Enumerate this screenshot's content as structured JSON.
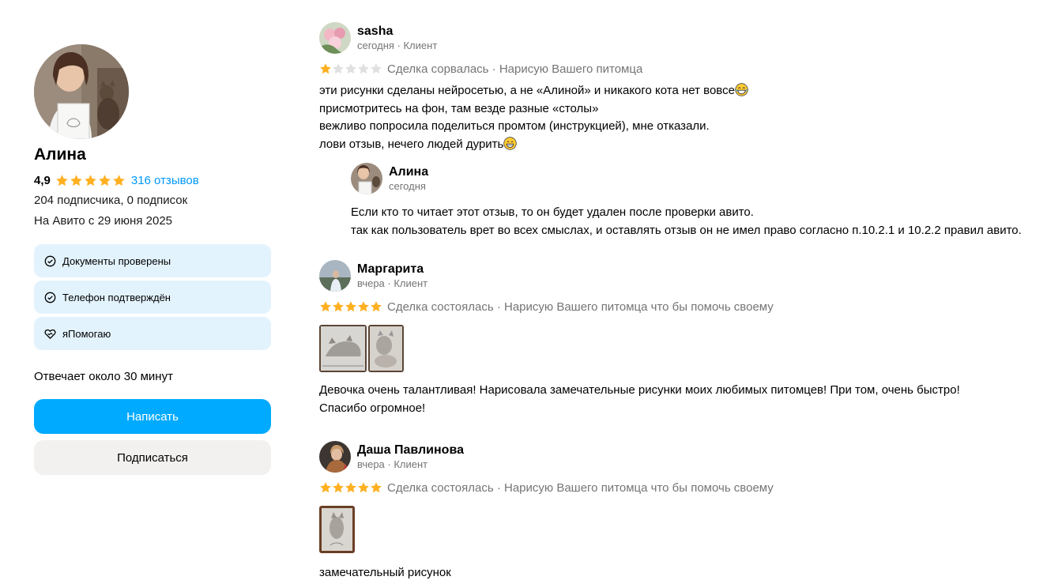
{
  "profile": {
    "name": "Алина",
    "rating": "4,9",
    "rating_stars": 5,
    "reviews_link": "316 отзывов",
    "followers": "204 подписчика, 0 подписок",
    "since": "На Авито с 29 июня 2025",
    "badges": [
      {
        "label": "Документы проверены",
        "icon": "check-circle-icon"
      },
      {
        "label": "Телефон подтверждён",
        "icon": "check-circle-icon"
      },
      {
        "label": "яПомогаю",
        "icon": "heart-hands-icon"
      }
    ],
    "responds": "Отвечает около 30 минут",
    "write_label": "Написать",
    "subscribe_label": "Подписаться"
  },
  "colors": {
    "accent": "#00aaff",
    "link": "#0099f7",
    "star": "#ffb021",
    "star_empty": "#e0e0e0",
    "badge_bg": "#e3f3fd",
    "button_secondary": "#f2f1f0"
  },
  "reviews": [
    {
      "author": "sasha",
      "meta": "сегодня · Клиент",
      "rating": 1,
      "deal": "Сделка сорвалась · Нарисую Вашего питомца",
      "lines": [
        "эти рисунки сделаны нейросетью, а не «Алиной» и никакого кота нет вовсе",
        "присмотритесь на фон, там везде разные «столы»",
        "вежливо попросила поделиться промтом (инструкцией), мне отказали.",
        "лови отзыв, нечего людей дурить"
      ],
      "reply": {
        "author": "Алина",
        "meta": "сегодня",
        "lines": [
          "Если кто то читает этот отзыв, то он будет удален после проверки авито.",
          "так как пользователь врет во всех смыслах, и оставлять отзыв он не имел право согласно п.10.2.1 и 10.2.2 правил авито."
        ]
      }
    },
    {
      "author": "Маргарита",
      "meta": "вчера · Клиент",
      "rating": 5,
      "deal": "Сделка состоялась · Нарисую Вашего питомца что бы помочь своему",
      "lines": [
        "Девочка очень талантливая! Нарисовала замечательные рисунки моих любимых питомцев! При том, очень быстро!",
        "Спасибо огромное!"
      ]
    },
    {
      "author": "Даша Павлинова",
      "meta": "вчера · Клиент",
      "rating": 5,
      "deal": "Сделка состоялась · Нарисую Вашего питомца что бы помочь своему",
      "lines": [
        "замечательный рисунок"
      ]
    }
  ]
}
